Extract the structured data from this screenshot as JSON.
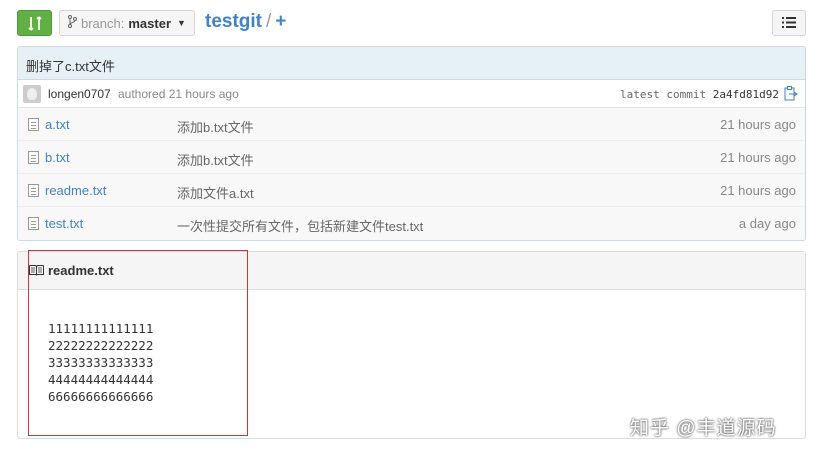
{
  "toolbar": {
    "branch_prefix": "branch:",
    "branch_name": "master",
    "repo_name": "testgit",
    "separator": "/",
    "new_file": "+"
  },
  "commit": {
    "message": "删掉了c.txt文件",
    "author": "longen0707",
    "authored_text": "authored 21 hours ago",
    "latest_label": "latest commit",
    "sha": "2a4fd81d92"
  },
  "files": [
    {
      "name": "a.txt",
      "message": "添加b.txt文件",
      "age": "21 hours ago"
    },
    {
      "name": "b.txt",
      "message": "添加b.txt文件",
      "age": "21 hours ago"
    },
    {
      "name": "readme.txt",
      "message": "添加文件a.txt",
      "age": "21 hours ago"
    },
    {
      "name": "test.txt",
      "message": "一次性提交所有文件，包括新建文件test.txt",
      "age": "a day ago"
    }
  ],
  "readme": {
    "title": "readme.txt",
    "lines": [
      "11111111111111",
      "22222222222222",
      "33333333333333",
      "44444444444444",
      "66666666666666"
    ]
  },
  "watermark": "知乎 @丰道源码",
  "colors": {
    "compare_green": "#60b044",
    "link_blue": "#4183c4",
    "commit_bar": "#e6f1f6",
    "highlight_red": "#c23a3a"
  }
}
